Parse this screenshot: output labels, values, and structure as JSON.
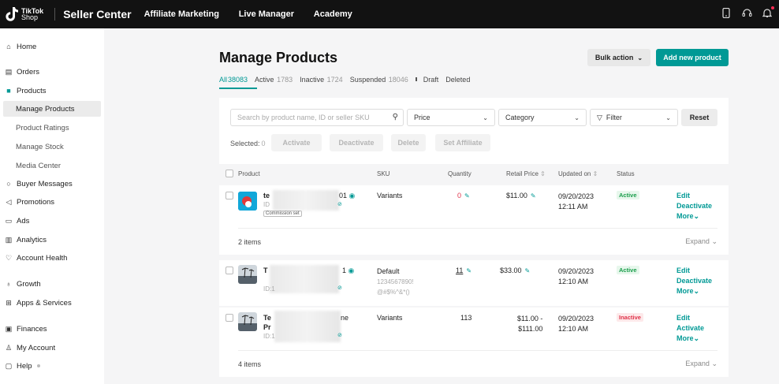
{
  "topbar": {
    "logo_line1": "TikTok",
    "logo_line2": "Shop",
    "brand": "Seller Center",
    "nav": [
      "Affiliate Marketing",
      "Live Manager",
      "Academy"
    ],
    "icons": [
      "phone-icon",
      "headset-icon",
      "bell-icon"
    ]
  },
  "sidebar": {
    "items": [
      {
        "label": "Home",
        "icon": "home-icon"
      },
      {
        "label": "Orders",
        "icon": "orders-icon"
      },
      {
        "label": "Products",
        "icon": "bag-icon"
      },
      {
        "label": "Manage Products"
      },
      {
        "label": "Product Ratings"
      },
      {
        "label": "Manage Stock"
      },
      {
        "label": "Media Center"
      },
      {
        "label": "Buyer Messages",
        "icon": "chat-icon"
      },
      {
        "label": "Promotions",
        "icon": "megaphone-icon"
      },
      {
        "label": "Ads",
        "icon": "ads-icon"
      },
      {
        "label": "Analytics",
        "icon": "analytics-icon"
      },
      {
        "label": "Account Health",
        "icon": "heart-icon"
      },
      {
        "label": "Growth",
        "icon": "growth-icon"
      },
      {
        "label": "Apps & Services",
        "icon": "apps-icon"
      },
      {
        "label": "Finances",
        "icon": "wallet-icon"
      },
      {
        "label": "My Account",
        "icon": "user-icon"
      },
      {
        "label": "Help",
        "icon": "help-icon"
      }
    ]
  },
  "page": {
    "title": "Manage Products",
    "bulk_action": "Bulk action",
    "add_new": "Add new product"
  },
  "tabs": [
    {
      "label": "All",
      "count": "38083"
    },
    {
      "label": "Active",
      "count": "1783"
    },
    {
      "label": "Inactive",
      "count": "1724"
    },
    {
      "label": "Suspended",
      "count": "18046"
    },
    {
      "label": "Draft",
      "count": ""
    },
    {
      "label": "Deleted",
      "count": ""
    }
  ],
  "filters": {
    "search_placeholder": "Search by product name, ID or seller SKU",
    "price": "Price",
    "category": "Category",
    "filter": "Filter",
    "reset": "Reset",
    "selected_label": "Selected:",
    "selected_count": "0",
    "bulk_buttons": [
      "Activate",
      "Deactivate",
      "Delete",
      "Set Affiliate"
    ]
  },
  "table": {
    "headers": {
      "product": "Product",
      "sku": "SKU",
      "quantity": "Quantity",
      "retail_price": "Retail Price",
      "updated_on": "Updated on",
      "status": "Status"
    },
    "rows": [
      {
        "name_start": "te",
        "name_end": "01",
        "id_prefix": "ID",
        "tag": "Commission set",
        "sku": "Variants",
        "sku_line2": "",
        "sku_line3": "",
        "quantity": "0",
        "price": "$11.00",
        "price2": "",
        "date": "09/20/2023",
        "time": "12:11 AM",
        "status": "Active",
        "actions": [
          "Edit",
          "Deactivate",
          "More"
        ],
        "foot": "2 items",
        "expand": "Expand"
      },
      {
        "name_start": "T",
        "name_end": "1",
        "id_prefix": "ID:1",
        "sku": "Default",
        "sku_line2": "1234567890!",
        "sku_line3": "@#$%^&*()",
        "quantity": "11",
        "price": "$33.00",
        "price2": "",
        "date": "09/20/2023",
        "time": "12:10 AM",
        "status": "Active",
        "actions": [
          "Edit",
          "Deactivate",
          "More"
        ]
      },
      {
        "name_start": "Te",
        "name_end": "ne",
        "name_line2": "Pr",
        "id_prefix": "ID:1",
        "sku": "Variants",
        "quantity": "113",
        "price": "$11.00 -",
        "price2": "$111.00",
        "date": "09/20/2023",
        "time": "12:10 AM",
        "status": "Inactive",
        "actions": [
          "Edit",
          "Activate",
          "More"
        ],
        "foot": "4 items",
        "expand": "Expand"
      }
    ]
  },
  "colors": {
    "accent": "#009995",
    "topbar": "#121212",
    "active_badge": "#1a9e4b",
    "inactive_badge": "#e0334a"
  }
}
